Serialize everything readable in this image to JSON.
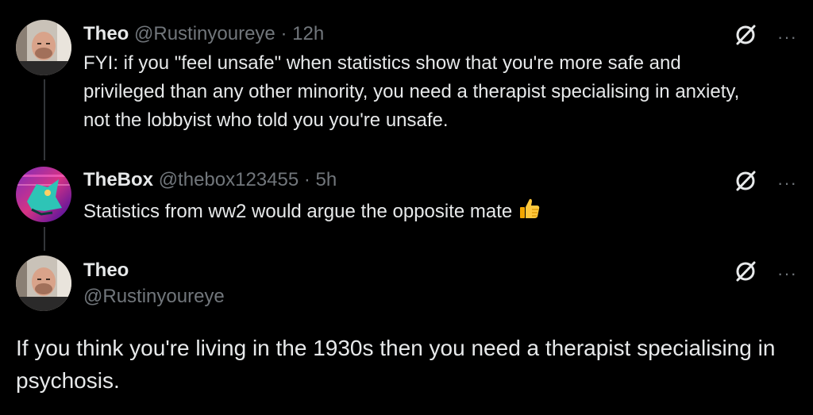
{
  "tweets": [
    {
      "name": "Theo",
      "handle": "@Rustinyoureye",
      "sep": "·",
      "time": "12h",
      "text": "FYI: if you \"feel unsafe\" when statistics show that you're more safe and privileged than any other minority, you need a therapist specialising in anxiety, not the lobbyist who told you you're unsafe."
    },
    {
      "name": "TheBox",
      "handle": "@thebox123455",
      "sep": "·",
      "time": "5h",
      "text": "Statistics from ww2 would argue the opposite mate",
      "emoji": "thumbs-up-icon"
    }
  ],
  "main_tweet": {
    "name": "Theo",
    "handle": "@Rustinyoureye",
    "text": "If you think you're living in the 1930s then you need a therapist specialising in psychosis."
  },
  "icons": {
    "grok": "grok-icon",
    "more": "more-icon",
    "more_glyph": "···"
  },
  "colors": {
    "background": "#000000",
    "text": "#e7e9ea",
    "muted": "#71767b",
    "thread_line": "#333639"
  }
}
